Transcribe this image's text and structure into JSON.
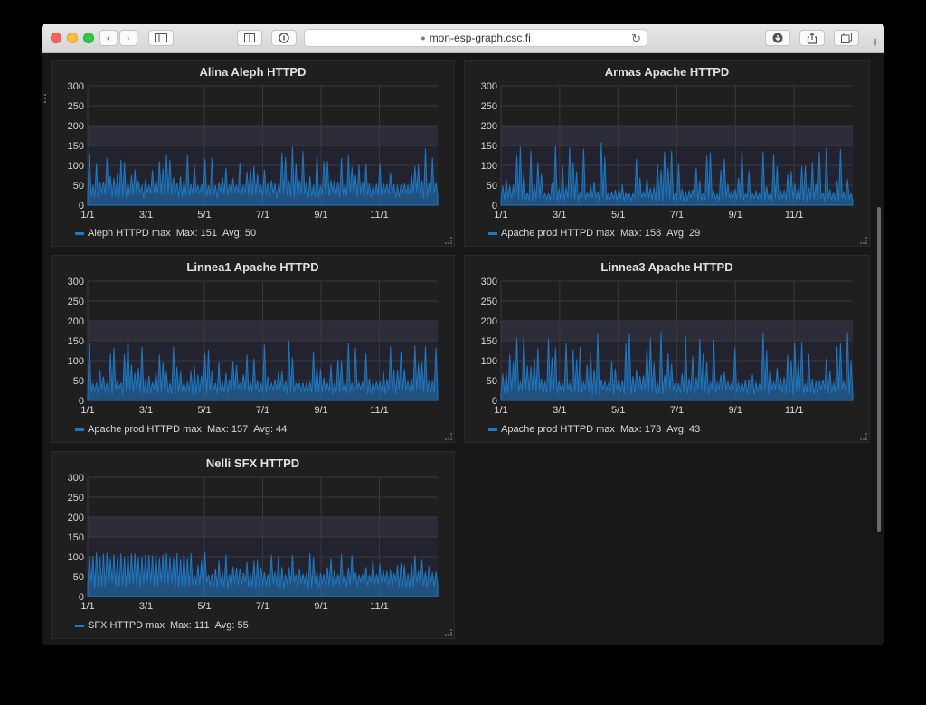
{
  "browser": {
    "url": "mon-esp-graph.csc.fi",
    "back_icon": "chevron-left-icon",
    "forward_icon": "chevron-right-icon"
  },
  "panels": [
    {
      "title": "Alina Aleph HTTPD",
      "legend": {
        "series": "Aleph HTTPD max",
        "max": "Max: 151",
        "avg": "Avg: 50"
      }
    },
    {
      "title": "Armas Apache HTTPD",
      "legend": {
        "series": "Apache prod HTTPD max",
        "max": "Max: 158",
        "avg": "Avg: 29"
      }
    },
    {
      "title": "Linnea1 Apache HTTPD",
      "legend": {
        "series": "Apache prod HTTPD max",
        "max": "Max: 157",
        "avg": "Avg: 44"
      }
    },
    {
      "title": "Linnea3 Apache HTTPD",
      "legend": {
        "series": "Apache prod HTTPD max",
        "max": "Max: 173",
        "avg": "Avg: 43"
      }
    },
    {
      "title": "Nelli SFX HTTPD",
      "legend": {
        "series": "SFX HTTPD max",
        "max": "Max: 111",
        "avg": "Avg: 55"
      }
    }
  ],
  "chart_data": [
    {
      "type": "area",
      "x_ticks": [
        "1/1",
        "3/1",
        "5/1",
        "7/1",
        "9/1",
        "11/1"
      ],
      "y_ticks": [
        0,
        50,
        100,
        150,
        200,
        250,
        300
      ],
      "ylim": [
        0,
        300
      ],
      "threshold_band": [
        150,
        200
      ],
      "series": [
        {
          "name": "Aleph HTTPD max",
          "max": 151,
          "avg": 50,
          "color": "#1f78c1"
        }
      ]
    },
    {
      "type": "area",
      "x_ticks": [
        "1/1",
        "3/1",
        "5/1",
        "7/1",
        "9/1",
        "11/1"
      ],
      "y_ticks": [
        0,
        50,
        100,
        150,
        200,
        250,
        300
      ],
      "ylim": [
        0,
        300
      ],
      "threshold_band": [
        150,
        200
      ],
      "series": [
        {
          "name": "Apache prod HTTPD max",
          "max": 158,
          "avg": 29,
          "color": "#1f78c1"
        }
      ]
    },
    {
      "type": "area",
      "x_ticks": [
        "1/1",
        "3/1",
        "5/1",
        "7/1",
        "9/1",
        "11/1"
      ],
      "y_ticks": [
        0,
        50,
        100,
        150,
        200,
        250,
        300
      ],
      "ylim": [
        0,
        300
      ],
      "threshold_band": [
        150,
        200
      ],
      "series": [
        {
          "name": "Apache prod HTTPD max",
          "max": 157,
          "avg": 44,
          "color": "#1f78c1"
        }
      ]
    },
    {
      "type": "area",
      "x_ticks": [
        "1/1",
        "3/1",
        "5/1",
        "7/1",
        "9/1",
        "11/1"
      ],
      "y_ticks": [
        0,
        50,
        100,
        150,
        200,
        250,
        300
      ],
      "ylim": [
        0,
        300
      ],
      "threshold_band": [
        150,
        200
      ],
      "series": [
        {
          "name": "Apache prod HTTPD max",
          "max": 173,
          "avg": 43,
          "color": "#1f78c1"
        }
      ]
    },
    {
      "type": "area",
      "x_ticks": [
        "1/1",
        "3/1",
        "5/1",
        "7/1",
        "9/1",
        "11/1"
      ],
      "y_ticks": [
        0,
        50,
        100,
        150,
        200,
        250,
        300
      ],
      "ylim": [
        0,
        300
      ],
      "threshold_band": [
        150,
        200
      ],
      "series": [
        {
          "name": "SFX HTTPD max",
          "max": 111,
          "avg": 55,
          "color": "#1f78c1"
        }
      ]
    }
  ]
}
